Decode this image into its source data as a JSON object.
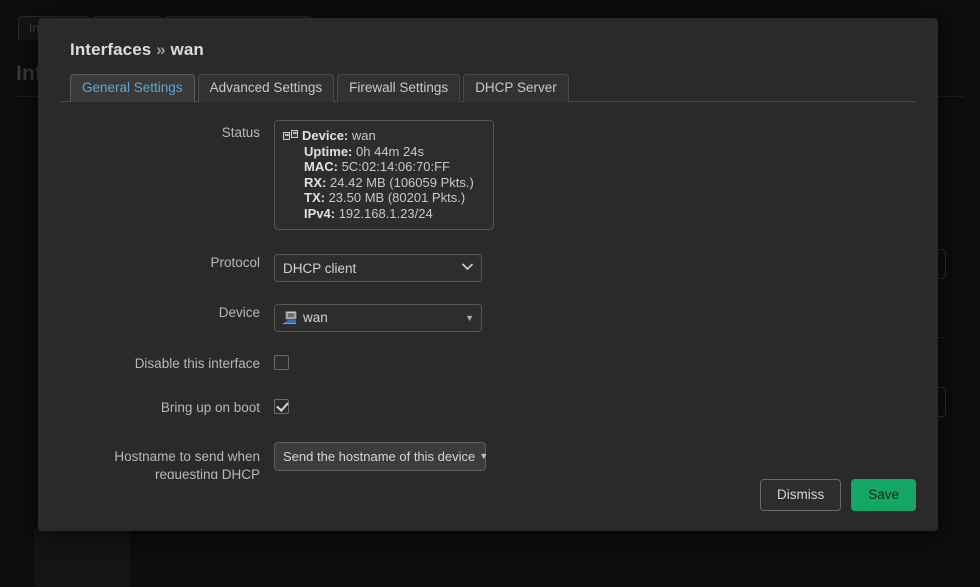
{
  "background": {
    "tabs": [
      "Interfaces",
      "",
      ""
    ],
    "heading": "Int",
    "tab_label_visible": "Int"
  },
  "modal": {
    "title_prefix": "Interfaces",
    "title_separator": "»",
    "title_name": "wan",
    "tabs": [
      {
        "label": "General Settings",
        "active": true
      },
      {
        "label": "Advanced Settings",
        "active": false
      },
      {
        "label": "Firewall Settings",
        "active": false
      },
      {
        "label": "DHCP Server",
        "active": false
      }
    ],
    "fields": {
      "status": {
        "label": "Status",
        "icon": "ethernet-icon",
        "lines": [
          {
            "key": "Device:",
            "value": "wan"
          },
          {
            "key": "Uptime:",
            "value": "0h 44m 24s"
          },
          {
            "key": "MAC:",
            "value": "5C:02:14:06:70:FF"
          },
          {
            "key": "RX:",
            "value": "24.42 MB (106059 Pkts.)"
          },
          {
            "key": "TX:",
            "value": "23.50 MB (80201 Pkts.)"
          },
          {
            "key": "IPv4:",
            "value": "192.168.1.23/24"
          }
        ]
      },
      "protocol": {
        "label": "Protocol",
        "value": "DHCP client",
        "options": [
          "DHCP client"
        ]
      },
      "device": {
        "label": "Device",
        "value": "wan",
        "icon": "network-device-icon"
      },
      "disable_interface": {
        "label": "Disable this interface",
        "checked": false
      },
      "bring_up_on_boot": {
        "label": "Bring up on boot",
        "checked": true
      },
      "hostname": {
        "label_line1": "Hostname to send when",
        "label_line2": "requesting DHCP",
        "value": "Send the hostname of this device"
      }
    },
    "footer": {
      "dismiss_label": "Dismiss",
      "save_label": "Save"
    }
  },
  "colors": {
    "accent_blue": "#5fa8d3",
    "save_green": "#14a766",
    "modal_bg": "#2a2a2a",
    "page_bg": "#0d0d0d"
  }
}
